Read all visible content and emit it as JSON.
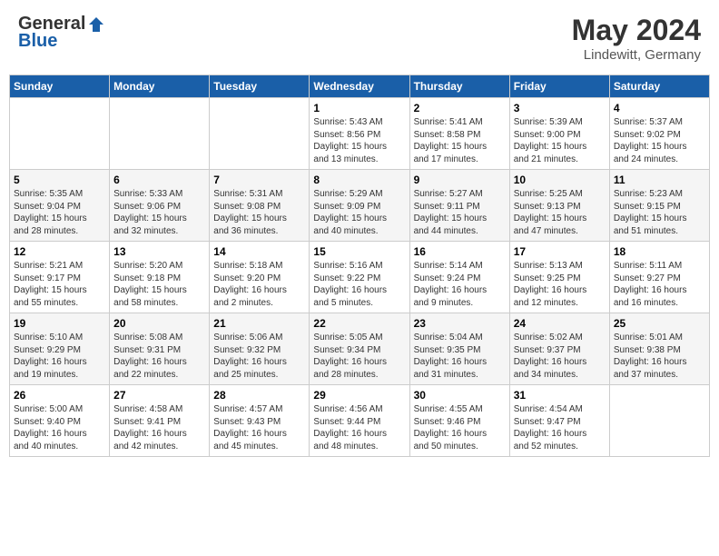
{
  "logo": {
    "general": "General",
    "blue": "Blue"
  },
  "title": {
    "month_year": "May 2024",
    "location": "Lindewitt, Germany"
  },
  "weekdays": [
    "Sunday",
    "Monday",
    "Tuesday",
    "Wednesday",
    "Thursday",
    "Friday",
    "Saturday"
  ],
  "weeks": [
    [
      {
        "day": "",
        "info": ""
      },
      {
        "day": "",
        "info": ""
      },
      {
        "day": "",
        "info": ""
      },
      {
        "day": "1",
        "info": "Sunrise: 5:43 AM\nSunset: 8:56 PM\nDaylight: 15 hours\nand 13 minutes."
      },
      {
        "day": "2",
        "info": "Sunrise: 5:41 AM\nSunset: 8:58 PM\nDaylight: 15 hours\nand 17 minutes."
      },
      {
        "day": "3",
        "info": "Sunrise: 5:39 AM\nSunset: 9:00 PM\nDaylight: 15 hours\nand 21 minutes."
      },
      {
        "day": "4",
        "info": "Sunrise: 5:37 AM\nSunset: 9:02 PM\nDaylight: 15 hours\nand 24 minutes."
      }
    ],
    [
      {
        "day": "5",
        "info": "Sunrise: 5:35 AM\nSunset: 9:04 PM\nDaylight: 15 hours\nand 28 minutes."
      },
      {
        "day": "6",
        "info": "Sunrise: 5:33 AM\nSunset: 9:06 PM\nDaylight: 15 hours\nand 32 minutes."
      },
      {
        "day": "7",
        "info": "Sunrise: 5:31 AM\nSunset: 9:08 PM\nDaylight: 15 hours\nand 36 minutes."
      },
      {
        "day": "8",
        "info": "Sunrise: 5:29 AM\nSunset: 9:09 PM\nDaylight: 15 hours\nand 40 minutes."
      },
      {
        "day": "9",
        "info": "Sunrise: 5:27 AM\nSunset: 9:11 PM\nDaylight: 15 hours\nand 44 minutes."
      },
      {
        "day": "10",
        "info": "Sunrise: 5:25 AM\nSunset: 9:13 PM\nDaylight: 15 hours\nand 47 minutes."
      },
      {
        "day": "11",
        "info": "Sunrise: 5:23 AM\nSunset: 9:15 PM\nDaylight: 15 hours\nand 51 minutes."
      }
    ],
    [
      {
        "day": "12",
        "info": "Sunrise: 5:21 AM\nSunset: 9:17 PM\nDaylight: 15 hours\nand 55 minutes."
      },
      {
        "day": "13",
        "info": "Sunrise: 5:20 AM\nSunset: 9:18 PM\nDaylight: 15 hours\nand 58 minutes."
      },
      {
        "day": "14",
        "info": "Sunrise: 5:18 AM\nSunset: 9:20 PM\nDaylight: 16 hours\nand 2 minutes."
      },
      {
        "day": "15",
        "info": "Sunrise: 5:16 AM\nSunset: 9:22 PM\nDaylight: 16 hours\nand 5 minutes."
      },
      {
        "day": "16",
        "info": "Sunrise: 5:14 AM\nSunset: 9:24 PM\nDaylight: 16 hours\nand 9 minutes."
      },
      {
        "day": "17",
        "info": "Sunrise: 5:13 AM\nSunset: 9:25 PM\nDaylight: 16 hours\nand 12 minutes."
      },
      {
        "day": "18",
        "info": "Sunrise: 5:11 AM\nSunset: 9:27 PM\nDaylight: 16 hours\nand 16 minutes."
      }
    ],
    [
      {
        "day": "19",
        "info": "Sunrise: 5:10 AM\nSunset: 9:29 PM\nDaylight: 16 hours\nand 19 minutes."
      },
      {
        "day": "20",
        "info": "Sunrise: 5:08 AM\nSunset: 9:31 PM\nDaylight: 16 hours\nand 22 minutes."
      },
      {
        "day": "21",
        "info": "Sunrise: 5:06 AM\nSunset: 9:32 PM\nDaylight: 16 hours\nand 25 minutes."
      },
      {
        "day": "22",
        "info": "Sunrise: 5:05 AM\nSunset: 9:34 PM\nDaylight: 16 hours\nand 28 minutes."
      },
      {
        "day": "23",
        "info": "Sunrise: 5:04 AM\nSunset: 9:35 PM\nDaylight: 16 hours\nand 31 minutes."
      },
      {
        "day": "24",
        "info": "Sunrise: 5:02 AM\nSunset: 9:37 PM\nDaylight: 16 hours\nand 34 minutes."
      },
      {
        "day": "25",
        "info": "Sunrise: 5:01 AM\nSunset: 9:38 PM\nDaylight: 16 hours\nand 37 minutes."
      }
    ],
    [
      {
        "day": "26",
        "info": "Sunrise: 5:00 AM\nSunset: 9:40 PM\nDaylight: 16 hours\nand 40 minutes."
      },
      {
        "day": "27",
        "info": "Sunrise: 4:58 AM\nSunset: 9:41 PM\nDaylight: 16 hours\nand 42 minutes."
      },
      {
        "day": "28",
        "info": "Sunrise: 4:57 AM\nSunset: 9:43 PM\nDaylight: 16 hours\nand 45 minutes."
      },
      {
        "day": "29",
        "info": "Sunrise: 4:56 AM\nSunset: 9:44 PM\nDaylight: 16 hours\nand 48 minutes."
      },
      {
        "day": "30",
        "info": "Sunrise: 4:55 AM\nSunset: 9:46 PM\nDaylight: 16 hours\nand 50 minutes."
      },
      {
        "day": "31",
        "info": "Sunrise: 4:54 AM\nSunset: 9:47 PM\nDaylight: 16 hours\nand 52 minutes."
      },
      {
        "day": "",
        "info": ""
      }
    ]
  ]
}
